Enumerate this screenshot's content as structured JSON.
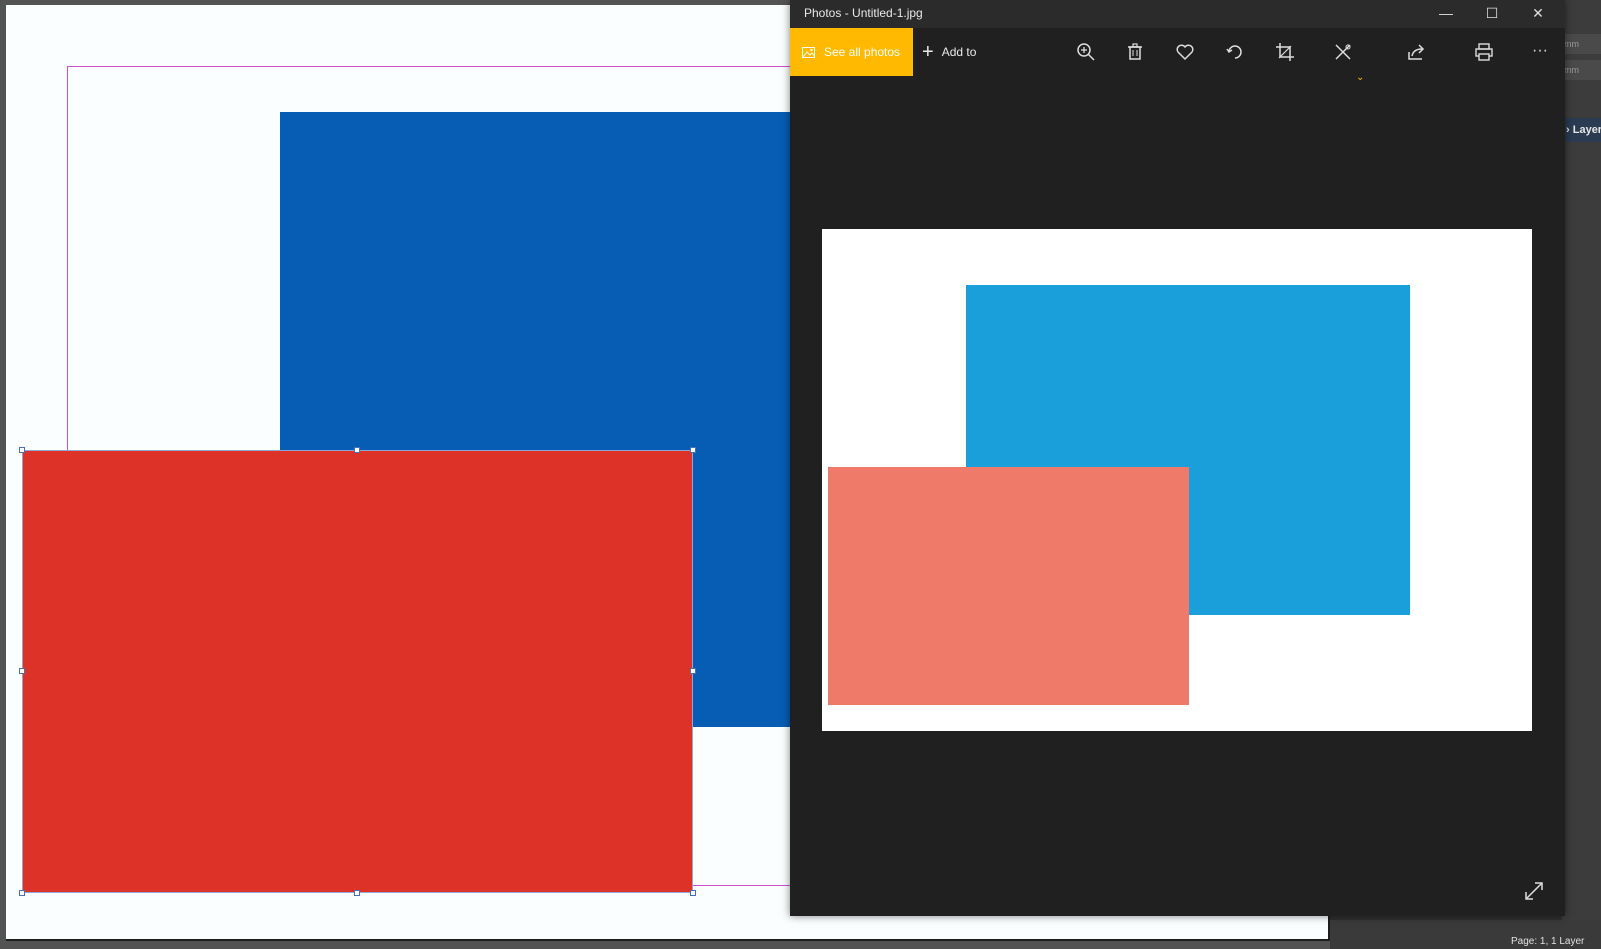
{
  "design_app": {
    "right_panel": {
      "unit_1": "mm",
      "unit_2": "mm",
      "layers_tab": "Layers"
    },
    "status": "Page: 1, 1 Layer"
  },
  "photos_window": {
    "title": "Photos - Untitled-1.jpg",
    "controls": {
      "minimize": "—",
      "maximize": "☐",
      "close": "✕"
    },
    "toolbar": {
      "see_all_photos": "See all photos",
      "add_to": "Add to",
      "more": "···",
      "icons": [
        "zoom-in-icon",
        "delete-icon",
        "favorite-icon",
        "rotate-icon",
        "crop-icon",
        "edit-icon",
        "share-icon",
        "print-icon"
      ]
    }
  },
  "colors": {
    "canvas_blue": "#075cb4",
    "canvas_red": "#dd3228",
    "preview_blue": "#1b9fda",
    "preview_salmon": "#ef7a6a",
    "accent": "#ffb900"
  }
}
